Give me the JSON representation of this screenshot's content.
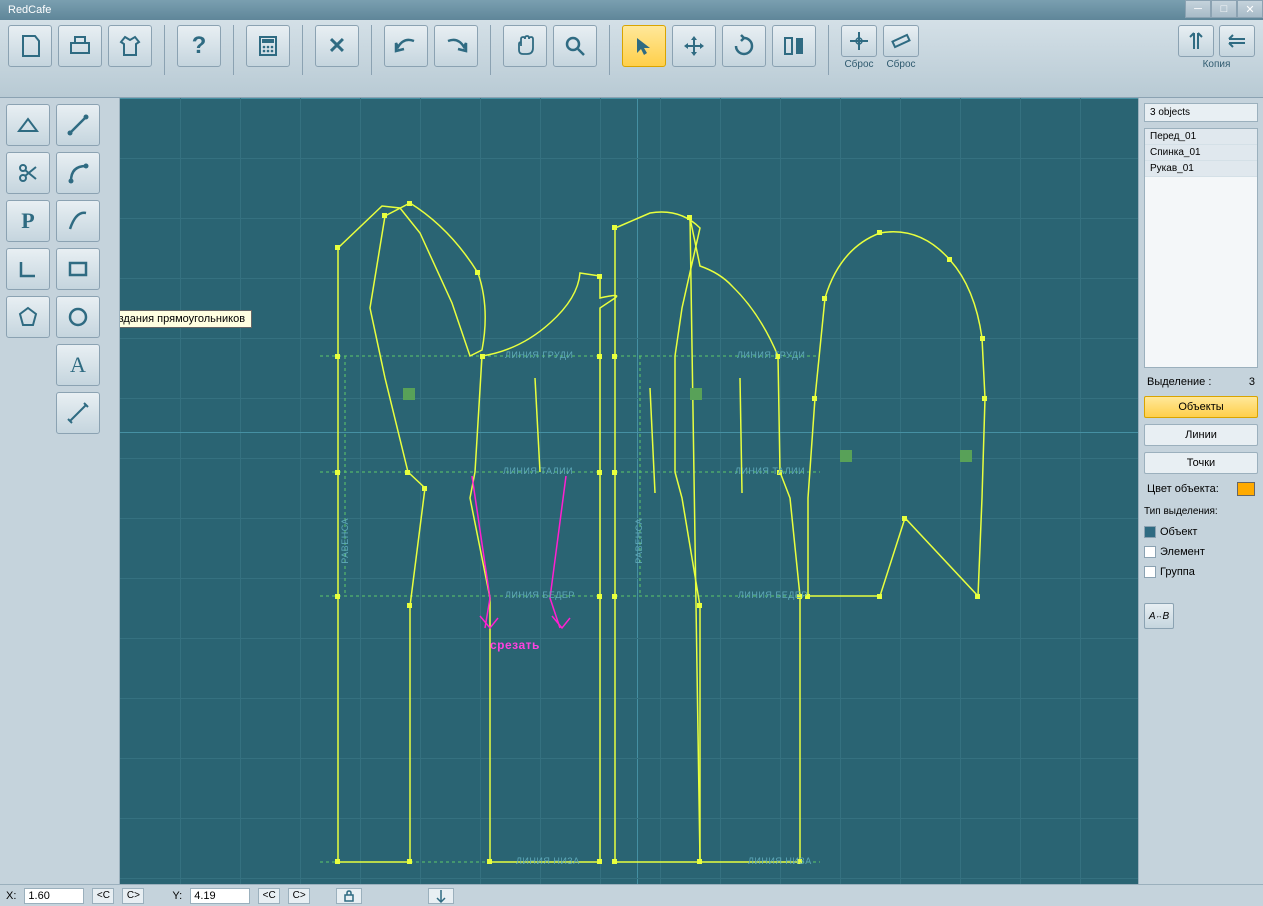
{
  "titlebar": {
    "title": "RedCafe"
  },
  "toolbar": {
    "reset1": "Сброс",
    "reset2": "Сброс",
    "copy": "Копия"
  },
  "tooltip": {
    "text": "Режим создания прямоугольников"
  },
  "canvas": {
    "labels": {
      "chest1": "ЛИНИЯ ГРУДИ",
      "chest2": "ЛИНИЯ ГРУДИ",
      "waist1": "ЛИНИЯ ТАЛИИ",
      "waist2": "ЛИНИЯ ТАЛИИ",
      "hip1": "ЛИНИЯ БЕДЕР",
      "hip2": "ЛИНИЯ БЕДЕР",
      "bottom1": "ЛИНИЯ НИЗА",
      "bottom2": "ЛИНИЯ НИЗА",
      "balance1": "РАВЕНСА",
      "balance2": "РАВЕНСА",
      "cut": "срезать"
    }
  },
  "right": {
    "count": "3 objects",
    "items": [
      "Перед_01",
      "Спинка_01",
      "Рукав_01"
    ],
    "selection_label": "Выделение :",
    "selection_count": "3",
    "btn_objects": "Объекты",
    "btn_lines": "Линии",
    "btn_points": "Точки",
    "color_label": "Цвет объекта:",
    "seltype_label": "Тип выделения:",
    "check_object": "Объект",
    "check_element": "Элемент",
    "check_group": "Группа",
    "rename": "A↔B"
  },
  "status": {
    "x_label": "X:",
    "x_value": "1.60",
    "y_label": "Y:",
    "y_value": "4.19",
    "c_lt": "<C",
    "c_gt": "C>"
  }
}
